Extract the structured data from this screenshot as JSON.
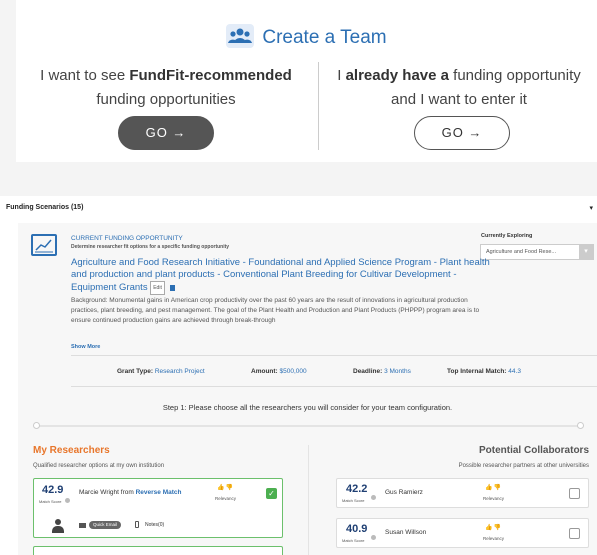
{
  "team": {
    "title": "Create a Team",
    "left_prefix": "I want to see ",
    "left_bold": "FundFit-recommended",
    "left_suffix": "funding opportunities",
    "right_prefix": "I ",
    "right_bold": "already have a",
    "right_suffix1": " funding opportunity",
    "right_suffix2": "and I want to enter it",
    "go_label": "GO →"
  },
  "scenarios": {
    "header": "Funding Scenarios (15)",
    "toggle": "▾"
  },
  "opportunity": {
    "label": "CURRENT FUNDING OPPORTUNITY",
    "sub": "Determine researcher fit options for a specific funding opportunity",
    "explore_label": "Currently Exploring",
    "explore_value": "Agriculture and Food Rese...",
    "title": "Agriculture and Food Research Initiative - Foundational and Applied Science Program - Plant health and production and plant products - Conventional Plant Breeding for Cultivar Development - Equipment Grants",
    "edit_label": "Edit",
    "background": "Background: Monumental gains in American crop productivity over the past 60 years are the result of innovations in agricultural production practices, plant breeding, and pest management. The goal of the Plant Health and Production and Plant Products (PHPPP) program area is to ensure continued production gains are achieved through break-through",
    "show_more": "Show More",
    "grant_type_label": "Grant Type:",
    "grant_type": "Research Project",
    "amount_label": "Amount:",
    "amount": "$500,000",
    "deadline_label": "Deadline:",
    "deadline": "3 Months",
    "top_match_label": "Top Internal Match:",
    "top_match": "44.3"
  },
  "step1": "Step 1: Please choose all the researchers you will consider for your team configuration.",
  "my_researchers": {
    "title": "My Researchers",
    "sub": "Qualified researcher options at my own institution",
    "items": [
      {
        "score": "42.9",
        "score_label": "Match Score",
        "name": "Marcie Wright from ",
        "source": "Reverse Match",
        "relevancy": "Relevancy",
        "quick_email": "Quick Email",
        "notes": "Notes(0)"
      }
    ]
  },
  "collaborators": {
    "title": "Potential Collaborators",
    "sub": "Possible researcher partners at other universities",
    "items": [
      {
        "score": "42.2",
        "score_label": "Match Score",
        "name": "Gus Ramierz",
        "relevancy": "Relevancy"
      },
      {
        "score": "40.9",
        "score_label": "Match Score",
        "name": "Susan Willson",
        "relevancy": "Relevancy"
      }
    ]
  },
  "colors": {
    "accent": "#2c6fb3",
    "orange": "#e8762b",
    "green": "#4caf50"
  }
}
